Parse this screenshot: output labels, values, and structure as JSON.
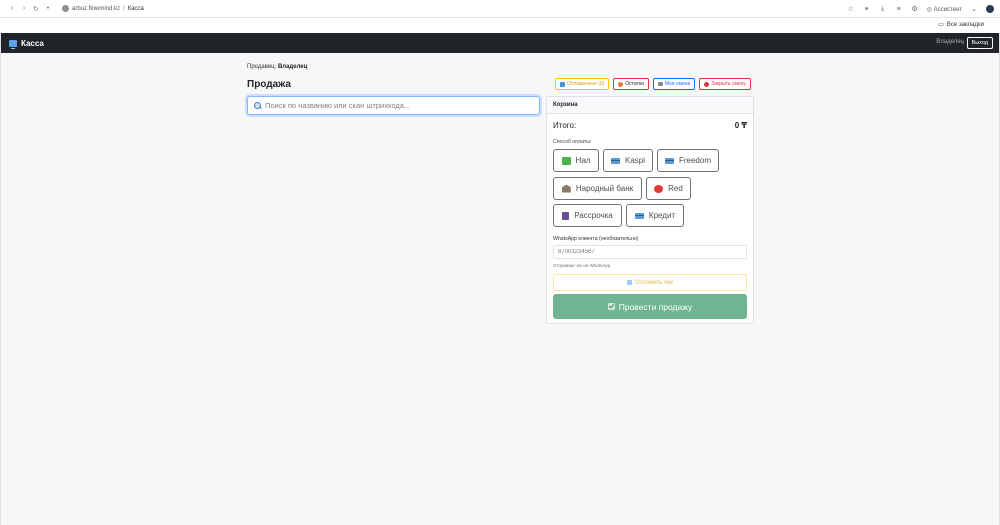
{
  "browser": {
    "domain": "arbuz.flowmind.kz",
    "separator": "/",
    "path": "Касса",
    "assistant_label": "Ассистент",
    "bookmarks_label": "Все закладки"
  },
  "navbar": {
    "brand": "Касса",
    "user": "Владелец",
    "logout": "Выход"
  },
  "seller": {
    "label": "Продавец:",
    "name": "Владелец"
  },
  "page_title": "Продажа",
  "search": {
    "placeholder": "Поиск по названию или скан штрихкода..."
  },
  "top_buttons": {
    "deferred": "Отложенные (0)",
    "stock": "Остатки",
    "my_shift": "Моя смена",
    "close_shift": "Закрыть смену"
  },
  "cart": {
    "title": "Корзина",
    "total_label": "Итого:",
    "total_value": "0 ₸",
    "payment_label": "Способ оплаты:",
    "payment_methods": [
      "Нал",
      "Kaspi",
      "Freedom",
      "Народный банк",
      "Red",
      "Рассрочка",
      "Кредит"
    ],
    "whatsapp_label": "WhatsApp клиента (необязательно)",
    "whatsapp_placeholder": "87001234567",
    "whatsapp_hint": "Отправим чек на WhatsApp",
    "defer_button": "Отложить чек",
    "submit_button": "Провести продажу"
  },
  "colors": {
    "navbar": "#212529",
    "submit": "#6fb592",
    "focus": "#86b7fe"
  }
}
